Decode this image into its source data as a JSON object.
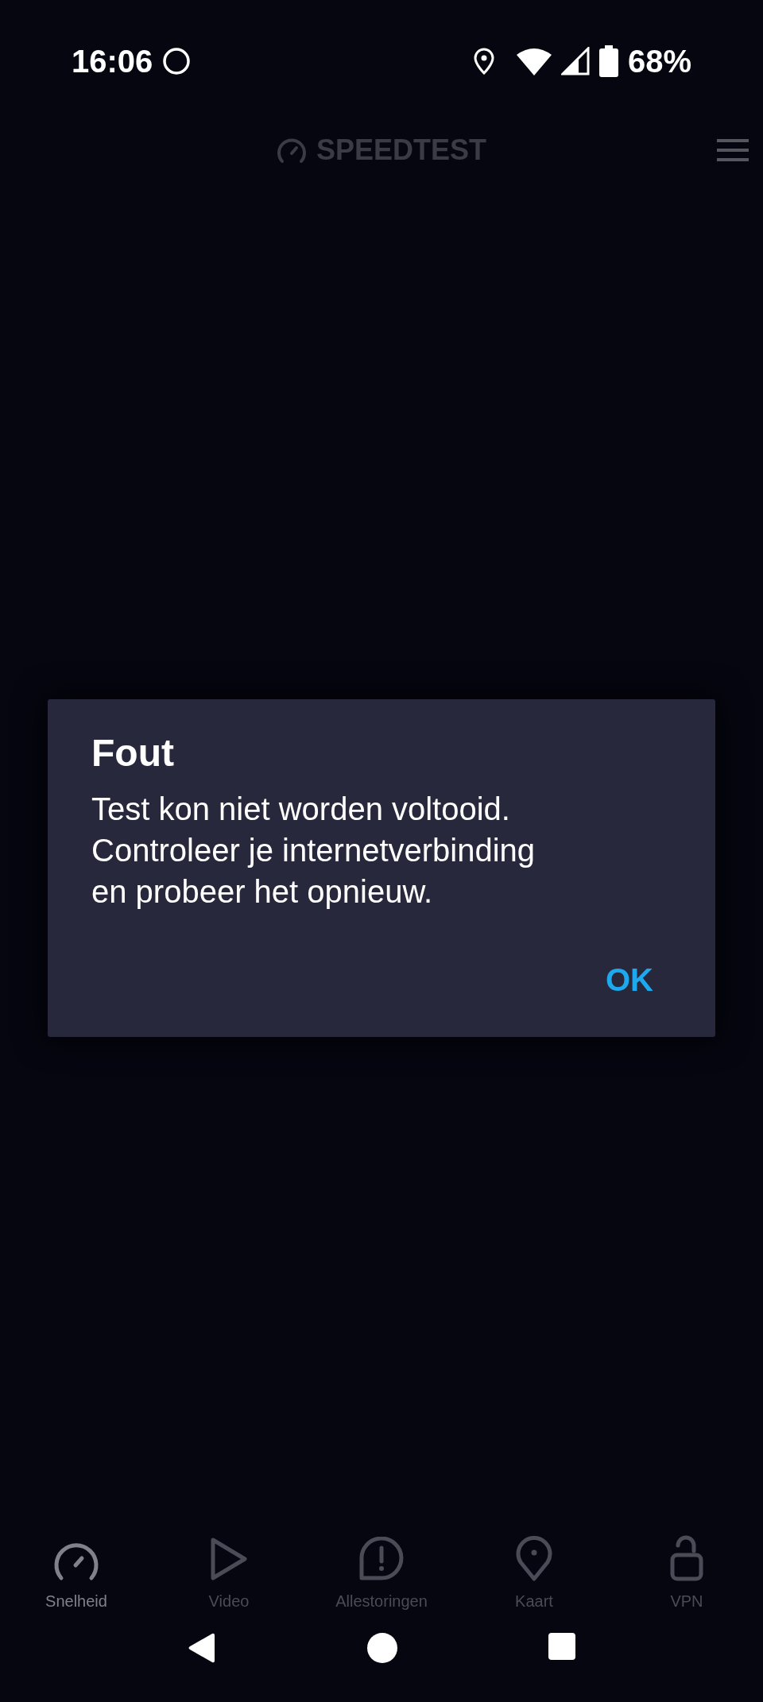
{
  "status_bar": {
    "time": "16:06",
    "battery": "68%"
  },
  "header": {
    "title": "SPEEDTEST"
  },
  "dialog": {
    "title": "Fout",
    "message": "Test kon niet worden voltooid.\nControleer je internetverbinding\nen probeer het opnieuw.",
    "button": "OK"
  },
  "tabs": [
    {
      "kind": "speed",
      "label": "Snelheid",
      "selected": true
    },
    {
      "kind": "video",
      "label": "Video",
      "selected": false
    },
    {
      "kind": "outage",
      "label": "Allestoringen",
      "selected": false
    },
    {
      "kind": "map",
      "label": "Kaart",
      "selected": false
    },
    {
      "kind": "vpn",
      "label": "VPN",
      "selected": false
    }
  ]
}
